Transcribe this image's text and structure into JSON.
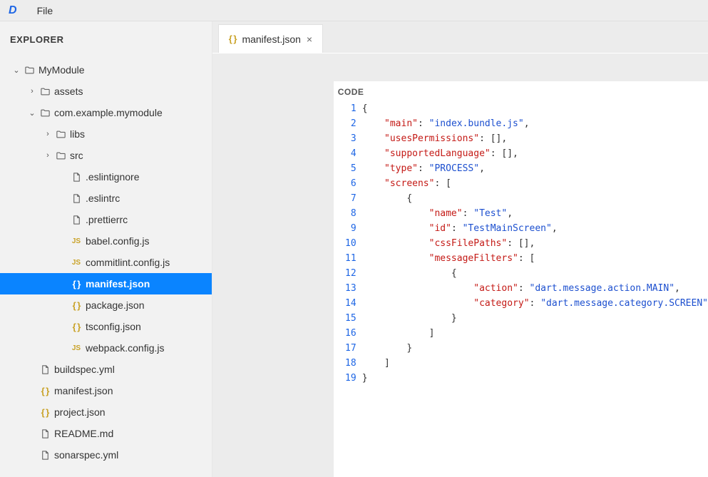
{
  "menubar": {
    "file": "File"
  },
  "sidebar": {
    "title": "EXPLORER",
    "tree": [
      {
        "depth": 0,
        "kind": "folder",
        "label": "MyModule",
        "expanded": true,
        "name": "tree-folder-mymodule"
      },
      {
        "depth": 1,
        "kind": "folder",
        "label": "assets",
        "expanded": false,
        "name": "tree-folder-assets"
      },
      {
        "depth": 1,
        "kind": "folder",
        "label": "com.example.mymodule",
        "expanded": true,
        "name": "tree-folder-com-example-mymodule"
      },
      {
        "depth": 2,
        "kind": "folder",
        "label": "libs",
        "expanded": false,
        "name": "tree-folder-libs"
      },
      {
        "depth": 2,
        "kind": "folder",
        "label": "src",
        "expanded": false,
        "name": "tree-folder-src"
      },
      {
        "depth": 3,
        "kind": "file",
        "label": ".eslintignore",
        "name": "tree-file-eslintignore"
      },
      {
        "depth": 3,
        "kind": "file",
        "label": ".eslintrc",
        "name": "tree-file-eslintrc"
      },
      {
        "depth": 3,
        "kind": "file",
        "label": ".prettierrc",
        "name": "tree-file-prettierrc"
      },
      {
        "depth": 3,
        "kind": "js",
        "label": "babel.config.js",
        "name": "tree-file-babel-config"
      },
      {
        "depth": 3,
        "kind": "js",
        "label": "commitlint.config.js",
        "name": "tree-file-commitlint-config"
      },
      {
        "depth": 3,
        "kind": "json",
        "label": "manifest.json",
        "selected": true,
        "name": "tree-file-manifest-json"
      },
      {
        "depth": 3,
        "kind": "json",
        "label": "package.json",
        "name": "tree-file-package-json"
      },
      {
        "depth": 3,
        "kind": "json",
        "label": "tsconfig.json",
        "name": "tree-file-tsconfig-json"
      },
      {
        "depth": 3,
        "kind": "js",
        "label": "webpack.config.js",
        "name": "tree-file-webpack-config"
      },
      {
        "depth": 1,
        "kind": "file",
        "label": "buildspec.yml",
        "name": "tree-file-buildspec"
      },
      {
        "depth": 1,
        "kind": "json",
        "label": "manifest.json",
        "name": "tree-file-root-manifest"
      },
      {
        "depth": 1,
        "kind": "json",
        "label": "project.json",
        "name": "tree-file-project-json"
      },
      {
        "depth": 1,
        "kind": "file",
        "label": "README.md",
        "name": "tree-file-readme"
      },
      {
        "depth": 1,
        "kind": "file",
        "label": "sonarspec.yml",
        "name": "tree-file-sonarspec"
      }
    ]
  },
  "tabs": [
    {
      "label": "manifest.json",
      "icon": "braces",
      "active": true
    }
  ],
  "editor": {
    "heading": "CODE",
    "lines": [
      {
        "n": 1,
        "t": [
          {
            "c": "punc",
            "v": "{"
          }
        ]
      },
      {
        "n": 2,
        "t": [
          {
            "c": "punc",
            "v": "    "
          },
          {
            "c": "key",
            "v": "\"main\""
          },
          {
            "c": "punc",
            "v": ": "
          },
          {
            "c": "str",
            "v": "\"index.bundle.js\""
          },
          {
            "c": "punc",
            "v": ","
          }
        ]
      },
      {
        "n": 3,
        "t": [
          {
            "c": "punc",
            "v": "    "
          },
          {
            "c": "key",
            "v": "\"usesPermissions\""
          },
          {
            "c": "punc",
            "v": ": [],"
          }
        ]
      },
      {
        "n": 4,
        "t": [
          {
            "c": "punc",
            "v": "    "
          },
          {
            "c": "key",
            "v": "\"supportedLanguage\""
          },
          {
            "c": "punc",
            "v": ": [],"
          }
        ]
      },
      {
        "n": 5,
        "t": [
          {
            "c": "punc",
            "v": "    "
          },
          {
            "c": "key",
            "v": "\"type\""
          },
          {
            "c": "punc",
            "v": ": "
          },
          {
            "c": "str",
            "v": "\"PROCESS\""
          },
          {
            "c": "punc",
            "v": ","
          }
        ]
      },
      {
        "n": 6,
        "t": [
          {
            "c": "punc",
            "v": "    "
          },
          {
            "c": "key",
            "v": "\"screens\""
          },
          {
            "c": "punc",
            "v": ": ["
          }
        ]
      },
      {
        "n": 7,
        "t": [
          {
            "c": "punc",
            "v": "        {"
          }
        ]
      },
      {
        "n": 8,
        "t": [
          {
            "c": "punc",
            "v": "            "
          },
          {
            "c": "key",
            "v": "\"name\""
          },
          {
            "c": "punc",
            "v": ": "
          },
          {
            "c": "str",
            "v": "\"Test\""
          },
          {
            "c": "punc",
            "v": ","
          }
        ]
      },
      {
        "n": 9,
        "t": [
          {
            "c": "punc",
            "v": "            "
          },
          {
            "c": "key",
            "v": "\"id\""
          },
          {
            "c": "punc",
            "v": ": "
          },
          {
            "c": "str",
            "v": "\"TestMainScreen\""
          },
          {
            "c": "punc",
            "v": ","
          }
        ]
      },
      {
        "n": 10,
        "t": [
          {
            "c": "punc",
            "v": "            "
          },
          {
            "c": "key",
            "v": "\"cssFilePaths\""
          },
          {
            "c": "punc",
            "v": ": [],"
          }
        ]
      },
      {
        "n": 11,
        "t": [
          {
            "c": "punc",
            "v": "            "
          },
          {
            "c": "key",
            "v": "\"messageFilters\""
          },
          {
            "c": "punc",
            "v": ": ["
          }
        ]
      },
      {
        "n": 12,
        "t": [
          {
            "c": "punc",
            "v": "                {"
          }
        ]
      },
      {
        "n": 13,
        "t": [
          {
            "c": "punc",
            "v": "                    "
          },
          {
            "c": "key",
            "v": "\"action\""
          },
          {
            "c": "punc",
            "v": ": "
          },
          {
            "c": "str",
            "v": "\"dart.message.action.MAIN\""
          },
          {
            "c": "punc",
            "v": ","
          }
        ]
      },
      {
        "n": 14,
        "t": [
          {
            "c": "punc",
            "v": "                    "
          },
          {
            "c": "key",
            "v": "\"category\""
          },
          {
            "c": "punc",
            "v": ": "
          },
          {
            "c": "str",
            "v": "\"dart.message.category.SCREEN\""
          }
        ]
      },
      {
        "n": 15,
        "t": [
          {
            "c": "punc",
            "v": "                }"
          }
        ]
      },
      {
        "n": 16,
        "t": [
          {
            "c": "punc",
            "v": "            ]"
          }
        ]
      },
      {
        "n": 17,
        "t": [
          {
            "c": "punc",
            "v": "        }"
          }
        ]
      },
      {
        "n": 18,
        "t": [
          {
            "c": "punc",
            "v": "    ]"
          }
        ]
      },
      {
        "n": 19,
        "t": [
          {
            "c": "punc",
            "v": "}"
          }
        ]
      }
    ]
  }
}
